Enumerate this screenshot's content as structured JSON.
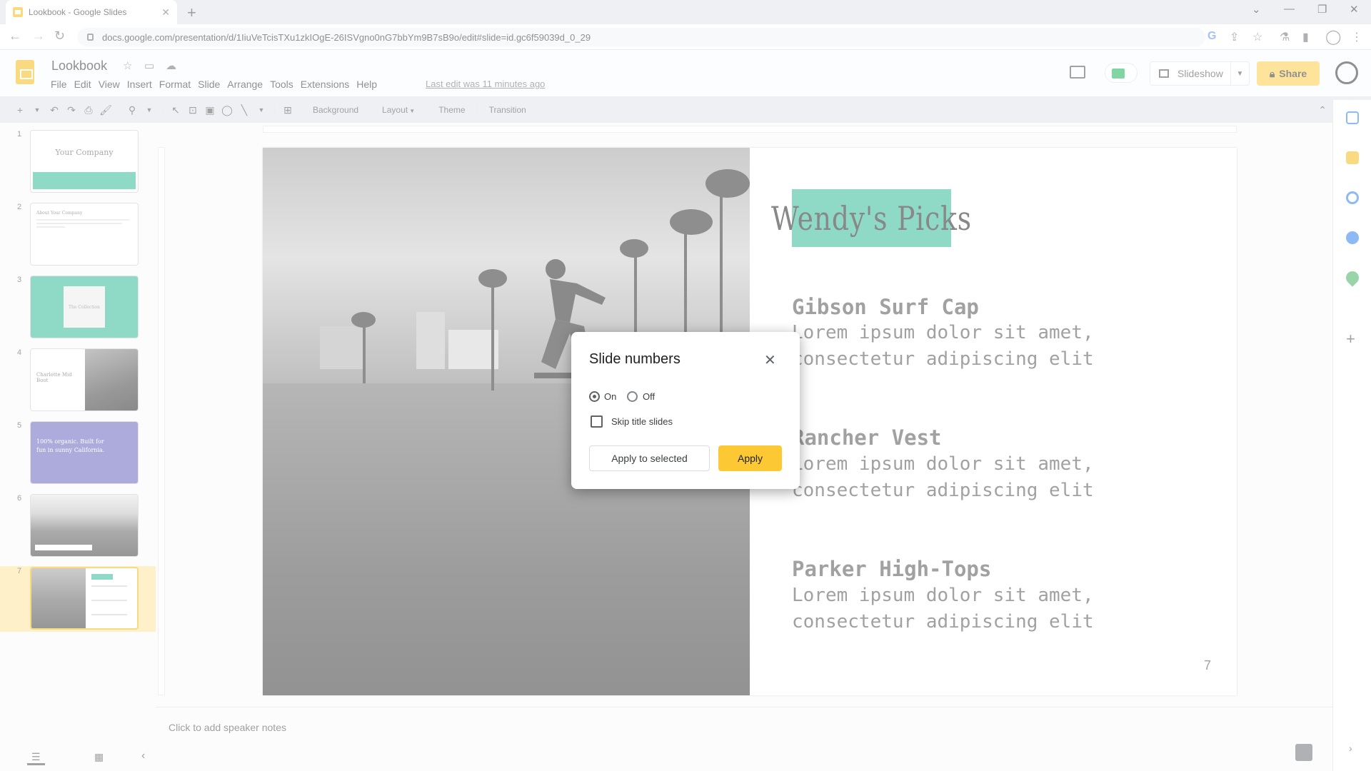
{
  "browser": {
    "tab_title": "Lookbook - Google Slides",
    "url": "docs.google.com/presentation/d/1IiuVeTcisTXu1zkIOgE-26ISVgno0nG7bbYm9B7sB9o/edit#slide=id.gc6f59039d_0_29"
  },
  "app": {
    "doc_title": "Lookbook",
    "menus": [
      "File",
      "Edit",
      "View",
      "Insert",
      "Format",
      "Slide",
      "Arrange",
      "Tools",
      "Extensions",
      "Help"
    ],
    "last_edit": "Last edit was 11 minutes ago",
    "slideshow_label": "Slideshow",
    "share_label": "Share"
  },
  "toolbar": {
    "background": "Background",
    "layout": "Layout",
    "theme": "Theme",
    "transition": "Transition"
  },
  "filmstrip": {
    "slides": [
      {
        "num": "1",
        "text": "Your Company",
        "sub": ""
      },
      {
        "num": "2",
        "text": "About Your Company",
        "sub": ""
      },
      {
        "num": "3",
        "text": "The Collection",
        "sub": ""
      },
      {
        "num": "4",
        "text": "Charlotte Mid Boot",
        "sub": ""
      },
      {
        "num": "5",
        "text": "100% organic. Built for fun in sunny California.",
        "sub": ""
      },
      {
        "num": "6",
        "text": "",
        "sub": ""
      },
      {
        "num": "7",
        "text": "",
        "sub": ""
      }
    ],
    "selected": "7"
  },
  "slide": {
    "heading": "Wendy's Picks",
    "products": [
      {
        "title": "Gibson Surf Cap",
        "desc": "Lorem ipsum dolor sit amet,\nconsectetur adipiscing elit"
      },
      {
        "title": "Rancher Vest",
        "desc": "Lorem ipsum dolor sit amet,\nconsectetur adipiscing elit"
      },
      {
        "title": "Parker High-Tops",
        "desc": "Lorem ipsum dolor sit amet,\nconsectetur adipiscing elit"
      }
    ],
    "page_number": "7"
  },
  "notes": {
    "placeholder": "Click to add speaker notes"
  },
  "dialog": {
    "title": "Slide numbers",
    "on_label": "On",
    "off_label": "Off",
    "selected": "On",
    "skip_label": "Skip title slides",
    "skip_checked": false,
    "apply_selected_label": "Apply to selected",
    "apply_label": "Apply"
  },
  "colors": {
    "accent": "#fcc934",
    "teal": "#1db58c",
    "purple": "#5b57b8"
  }
}
